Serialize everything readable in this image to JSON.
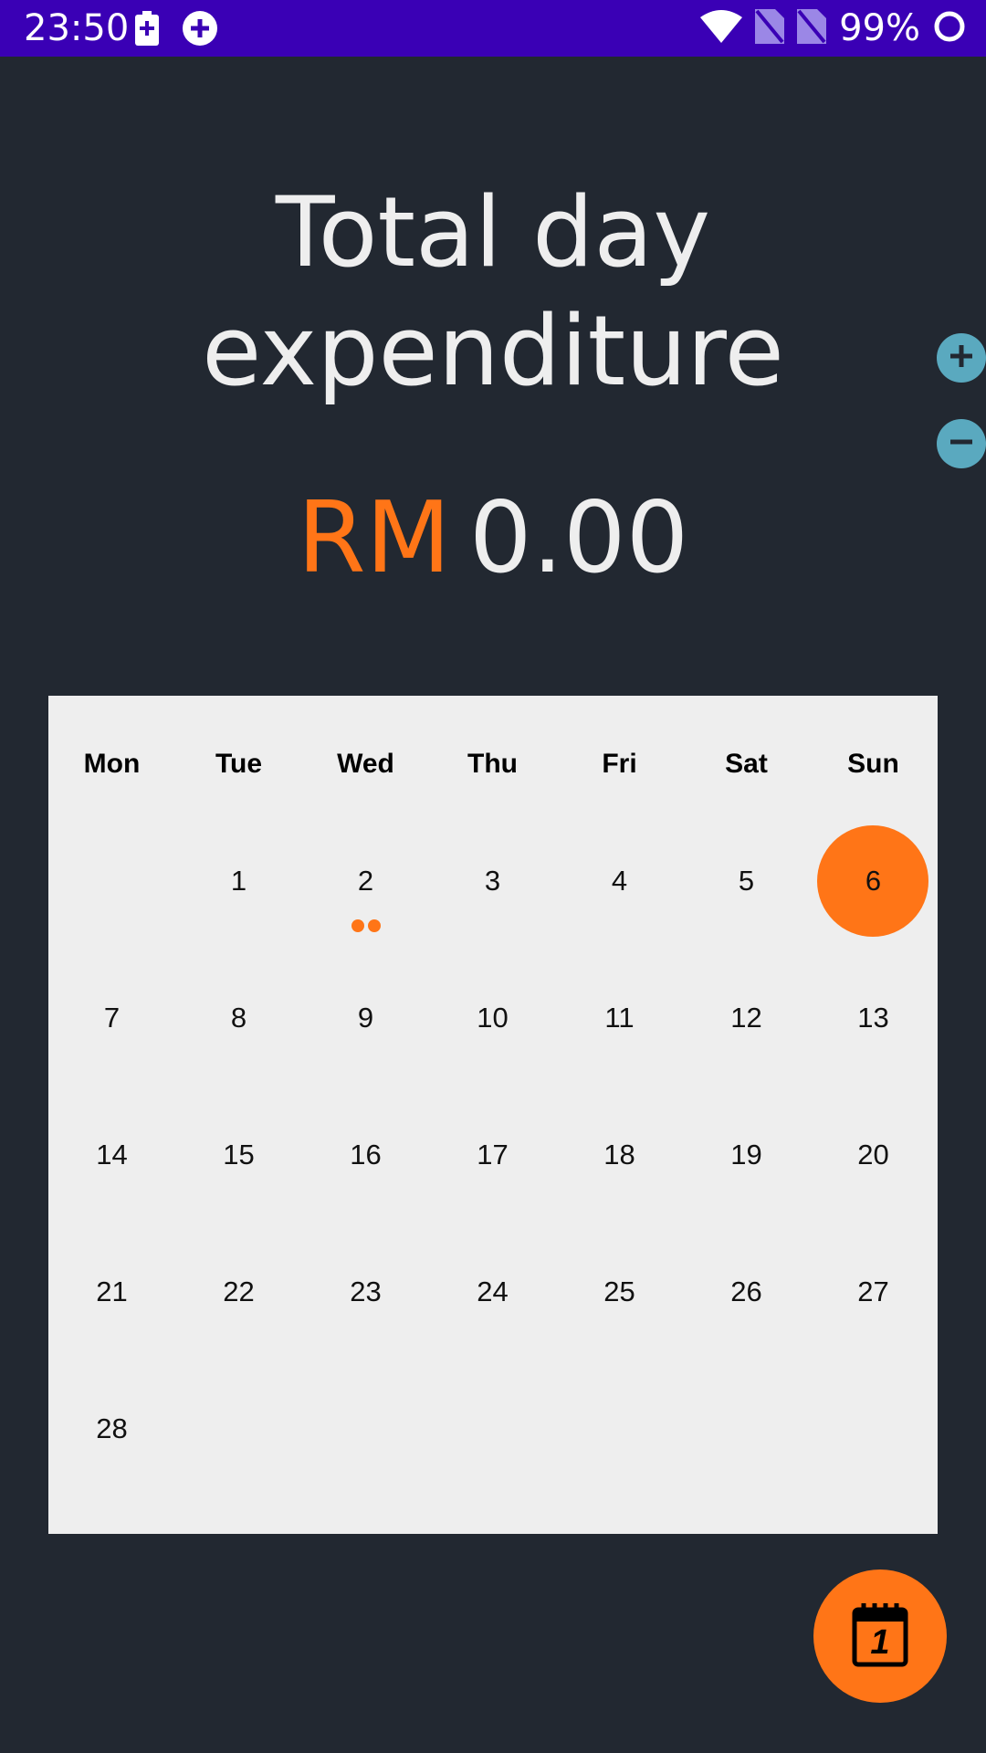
{
  "status_bar": {
    "time": "23:50",
    "battery": "99%",
    "bg_color": "#3a00b5",
    "icons": [
      "battery-charging-icon",
      "plus-circle-icon",
      "wifi-icon",
      "no-sim-icon",
      "no-sim-icon",
      "circle-icon"
    ]
  },
  "header": {
    "title_line1": "Total day",
    "title_line2": "expenditure"
  },
  "amount": {
    "currency": "RM",
    "value": "0.00"
  },
  "side_buttons": {
    "increase_icon": "plus-icon",
    "decrease_icon": "minus-icon"
  },
  "calendar": {
    "weekdays": [
      "Mon",
      "Tue",
      "Wed",
      "Thu",
      "Fri",
      "Sat",
      "Sun"
    ],
    "weeks": [
      [
        "",
        "1",
        "2",
        "3",
        "4",
        "5",
        "6"
      ],
      [
        "7",
        "8",
        "9",
        "10",
        "11",
        "12",
        "13"
      ],
      [
        "14",
        "15",
        "16",
        "17",
        "18",
        "19",
        "20"
      ],
      [
        "21",
        "22",
        "23",
        "24",
        "25",
        "26",
        "27"
      ],
      [
        "28",
        "",
        "",
        "",
        "",
        "",
        ""
      ]
    ],
    "selected_day": "6",
    "days_with_events": [
      "2"
    ],
    "accent_color": "#ff7517"
  },
  "fab": {
    "icon": "calendar-icon",
    "label": "1"
  },
  "colors": {
    "background": "#222831",
    "text": "#eeeeee",
    "accent": "#ff7517",
    "side_button": "#5aa9bf"
  }
}
